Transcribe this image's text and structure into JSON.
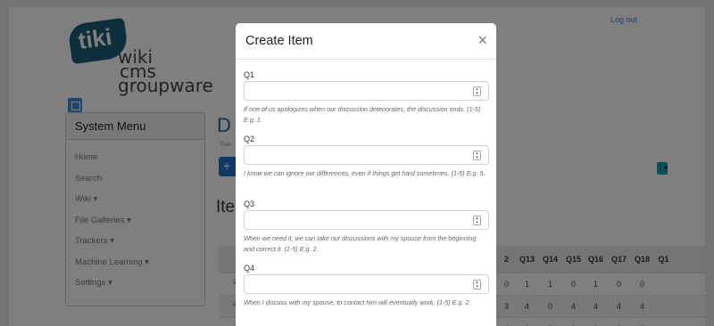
{
  "header": {
    "logout_label": "Log out"
  },
  "logo": {
    "badge": "tiki",
    "line1": "wiki",
    "line2": "cms",
    "line3": "groupware"
  },
  "system_menu": {
    "title": "System Menu",
    "items": [
      "Home",
      "Search",
      "Wiki ▾",
      "File Galleries ▾",
      "Trackers ▾",
      "Machine Learning ▾",
      "Settings ▾"
    ]
  },
  "main": {
    "title_initial": "D",
    "subtitle": "Train",
    "add_label": "+",
    "items_heading": "Ite",
    "actions_label": "⋮▾"
  },
  "table": {
    "headers": [
      "2",
      "Q13",
      "Q14",
      "Q15",
      "Q16",
      "Q17",
      "Q18",
      "Q1"
    ],
    "rows": [
      [
        "0",
        "1",
        "1",
        "0",
        "1",
        "0",
        "0",
        ""
      ],
      [
        "3",
        "4",
        "0",
        "4",
        "4",
        "4",
        "4",
        ""
      ],
      [
        "4",
        "3",
        "3",
        "3",
        "3",
        "3",
        "3",
        ""
      ]
    ]
  },
  "modal": {
    "title": "Create Item",
    "close": "×",
    "fields": [
      {
        "label": "Q1",
        "value": "",
        "help": "If one of us apologizes when our discussion deteriorates, the discussion ends. (1-5) E.g. 1."
      },
      {
        "label": "Q2",
        "value": "",
        "help": "I know we can ignore our differences, even if things get hard sometimes. (1-5) E.g. 5."
      },
      {
        "label": "Q3",
        "value": "",
        "help": "When we need it, we can take our discussions with my spouse from the beginning and correct it. (1-5) E.g. 2."
      },
      {
        "label": "Q4",
        "value": "",
        "help": "When I discuss with my spouse, to contact him will eventually work. (1-5) E.g. 2."
      }
    ]
  }
}
